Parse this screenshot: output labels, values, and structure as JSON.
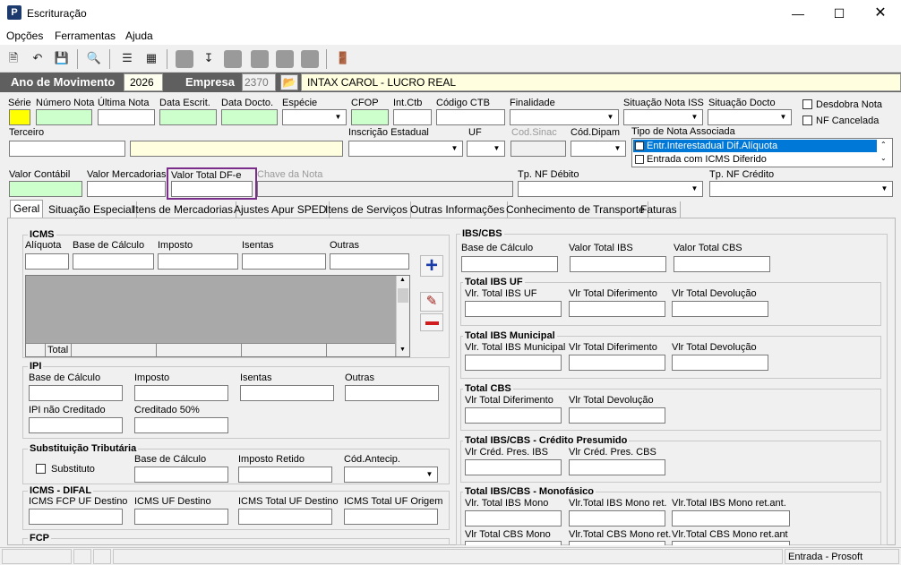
{
  "window": {
    "title": "Escrituração"
  },
  "menu": {
    "items": [
      "Opções",
      "Ferramentas",
      "Ajuda"
    ]
  },
  "header": {
    "ano_label": "Ano de Movimento",
    "ano_value": "2026",
    "empresa_label": "Empresa",
    "empresa_code": "2370",
    "empresa_name": "INTAX CAROL - LUCRO REAL"
  },
  "row1": {
    "serie": "Série",
    "numero": "Número Nota",
    "ultima": "Última Nota",
    "data_escrit": "Data Escrit.",
    "data_docto": "Data Docto.",
    "especie": "Espécie",
    "cfop": "CFOP",
    "int_ctb": "Int.Ctb",
    "codigo_ctb": "Código CTB",
    "finalidade": "Finalidade",
    "situacao_iss": "Situação Nota ISS",
    "situacao_docto": "Situação Docto",
    "desdobra": "Desdobra Nota",
    "nf_cancelada": "NF Cancelada"
  },
  "row2": {
    "terceiro": "Terceiro",
    "inscricao": "Inscrição Estadual",
    "uf": "UF",
    "cod_sinac": "Cod.Sinac",
    "cod_dipam": "Cód.Dipam",
    "tipo_nota": "Tipo de Nota Associada",
    "tipo_options": [
      "Entr.Interestadual Dif.Alíquota",
      "Entrada com ICMS Diferido"
    ]
  },
  "row3": {
    "valor_contabil": "Valor Contábil",
    "valor_mercadorias": "Valor Mercadorias",
    "valor_total_dfe": "Valor Total DF-e",
    "chave_nota": "Chave da Nota",
    "tp_nf_debito": "Tp. NF Débito",
    "tp_nf_credito": "Tp. NF Crédito"
  },
  "tabs": [
    "Geral",
    "Situação Especial",
    "Itens de Mercadorias",
    "Ajustes Apur SPED",
    "Itens de Serviços",
    "Outras Informações",
    "Conhecimento de Transporte",
    "Faturas"
  ],
  "icms": {
    "title": "ICMS",
    "aliquota": "Alíquota",
    "base": "Base de Cálculo",
    "imposto": "Imposto",
    "isentas": "Isentas",
    "outras": "Outras",
    "total": "Total"
  },
  "ipi": {
    "title": "IPI",
    "base": "Base de Cálculo",
    "imposto": "Imposto",
    "isentas": "Isentas",
    "outras": "Outras",
    "nao_creditado": "IPI não Creditado",
    "creditado50": "Creditado 50%"
  },
  "st": {
    "title": "Substituição Tributária",
    "substituto": "Substituto",
    "base": "Base de Cálculo",
    "imposto_retido": "Imposto Retido",
    "cod_antecip": "Cód.Antecip."
  },
  "difal": {
    "title": "ICMS - DIFAL",
    "fcp_uf_destino": "ICMS FCP UF Destino",
    "uf_destino": "ICMS UF Destino",
    "total_uf_destino": "ICMS Total UF Destino",
    "total_uf_origem": "ICMS Total UF Origem"
  },
  "fcp": {
    "title": "FCP"
  },
  "ibscbs": {
    "title": "IBS/CBS",
    "base": "Base de Cálculo",
    "valor_ibs": "Valor Total IBS",
    "valor_cbs": "Valor Total CBS"
  },
  "ibs_uf": {
    "title": "Total IBS UF",
    "vlr_total": "Vlr. Total IBS UF",
    "diferimento": "Vlr Total Diferimento",
    "devolucao": "Vlr Total Devolução"
  },
  "ibs_mun": {
    "title": "Total IBS Municipal",
    "vlr_total": "Vlr. Total IBS Municipal",
    "diferimento": "Vlr Total Diferimento",
    "devolucao": "Vlr Total Devolução"
  },
  "cbs": {
    "title": "Total CBS",
    "diferimento": "Vlr Total Diferimento",
    "devolucao": "Vlr Total Devolução"
  },
  "presumido": {
    "title": "Total IBS/CBS - Crédito Presumido",
    "ibs": "Vlr Créd. Pres. IBS",
    "cbs": "Vlr Créd. Pres. CBS"
  },
  "monofasico": {
    "title": "Total IBS/CBS - Monofásico",
    "ibs_mono": "Vlr. Total IBS Mono",
    "ibs_mono_ret": "Vlr.Total IBS Mono ret.",
    "ibs_mono_ret_ant": "Vlr.Total IBS Mono ret.ant.",
    "cbs_mono": "Vlr Total CBS Mono",
    "cbs_mono_ret": "Vlr.Total CBS Mono ret.",
    "cbs_mono_ret_ant": "Vlr.Total CBS Mono ret.ant"
  },
  "status": {
    "mode": "Entrada - Prosoft"
  },
  "colors": {
    "highlight": "#7b2d8b",
    "green_field": "#ccffcc",
    "yellow_field": "#ffff00",
    "header_bg": "#5f5f5f",
    "selected": "#0078d7"
  }
}
